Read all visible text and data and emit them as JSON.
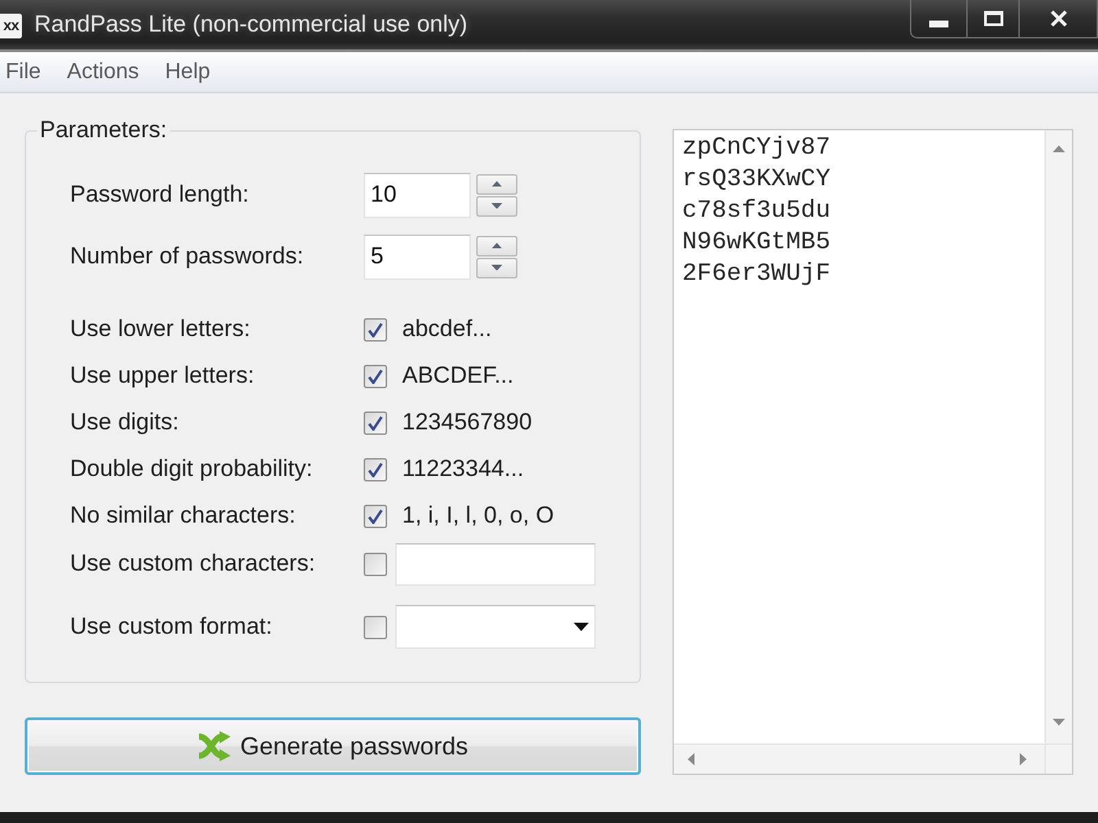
{
  "window": {
    "title": "RandPass Lite (non-commercial use only)",
    "icon_text": "xx"
  },
  "menu": [
    {
      "label": "File"
    },
    {
      "label": "Actions"
    },
    {
      "label": "Help"
    }
  ],
  "parameters": {
    "title": "Parameters:",
    "spinners": [
      {
        "label": "Password length:",
        "value": "10"
      },
      {
        "label": "Number of passwords:",
        "value": "5"
      }
    ],
    "options": [
      {
        "kind": "example",
        "label": "Use lower letters:",
        "checked": true,
        "example": "abcdef..."
      },
      {
        "kind": "example",
        "label": "Use upper letters:",
        "checked": true,
        "example": "ABCDEF..."
      },
      {
        "kind": "example",
        "label": "Use digits:",
        "checked": true,
        "example": "1234567890"
      },
      {
        "kind": "example",
        "label": "Double digit probability:",
        "checked": true,
        "example": "11223344..."
      },
      {
        "kind": "example",
        "label": "No similar characters:",
        "checked": true,
        "example": "1, i, I, l, 0, o, O"
      },
      {
        "kind": "text",
        "label": "Use custom characters:",
        "checked": false
      },
      {
        "kind": "select",
        "label": "Use custom format:",
        "checked": false
      }
    ]
  },
  "generate_button": {
    "label": "Generate passwords"
  },
  "output": {
    "lines": [
      "zpCnCYjv87",
      "rsQ33KXwCY",
      "c78sf3u5du",
      "N96wKGtMB5",
      "2F6er3WUjF"
    ]
  }
}
